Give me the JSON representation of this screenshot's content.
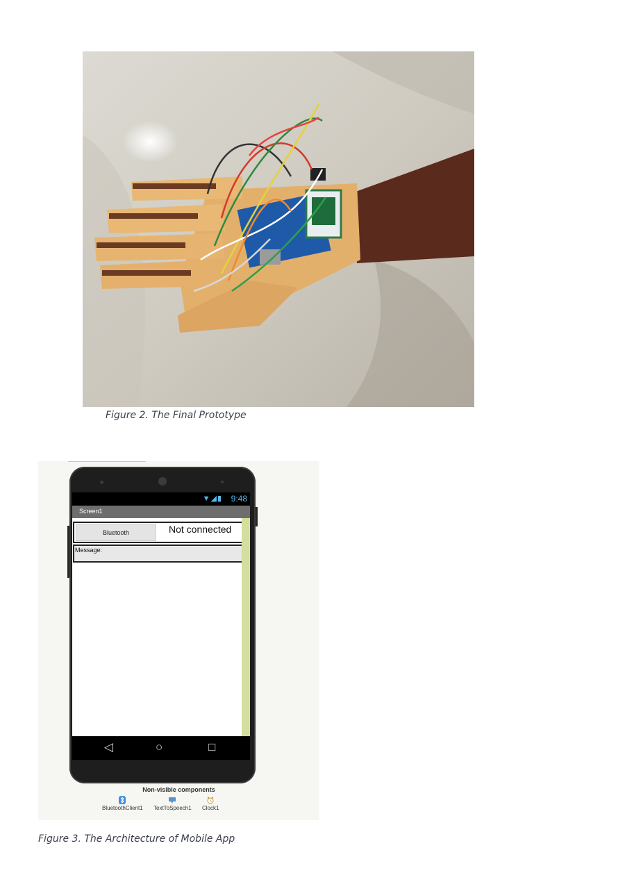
{
  "figure2": {
    "caption": "Figure 2. The Final Prototype"
  },
  "figure3": {
    "caption": "Figure 3. The Architecture of Mobile App",
    "phone": {
      "status_time": "9:48",
      "screen_title": "Screen1",
      "bluetooth_button": "Bluetooth",
      "connection_status": "Not connected",
      "message_label": "Message:"
    },
    "nonvisible": {
      "title": "Non-visible components",
      "items": [
        {
          "label": "BluetoothClient1",
          "icon": "bluetooth-icon"
        },
        {
          "label": "TextToSpeech1",
          "icon": "speech-bubble-icon"
        },
        {
          "label": "Clock1",
          "icon": "clock-icon"
        }
      ]
    }
  }
}
